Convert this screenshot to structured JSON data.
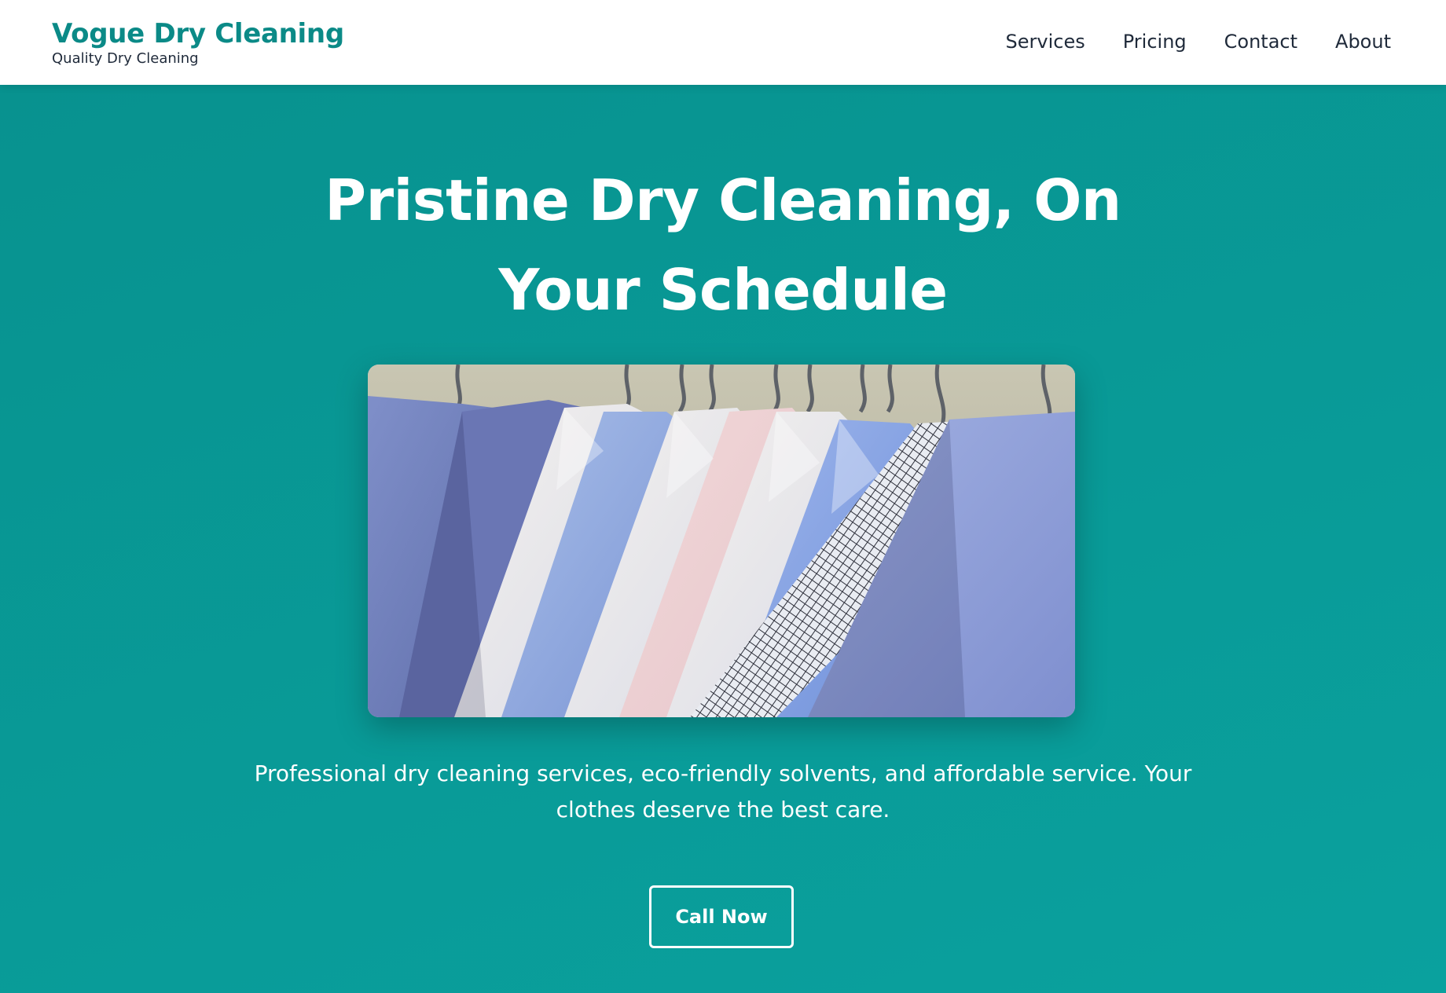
{
  "header": {
    "brand_title": "Vogue Dry Cleaning",
    "brand_tagline": "Quality Dry Cleaning",
    "nav": [
      "Services",
      "Pricing",
      "Contact",
      "About"
    ]
  },
  "hero": {
    "title": "Pristine Dry Cleaning, On Your Schedule",
    "image": "photo of dress shirts hanging on hangers",
    "description": "Professional dry cleaning services, eco-friendly solvents, and affordable service. Your clothes deserve the best care.",
    "cta_label": "Call Now"
  },
  "colors": {
    "brand": "#0b8a87",
    "hero_bg": "#089592",
    "nav_text": "#1f2a3a",
    "white": "#ffffff"
  }
}
